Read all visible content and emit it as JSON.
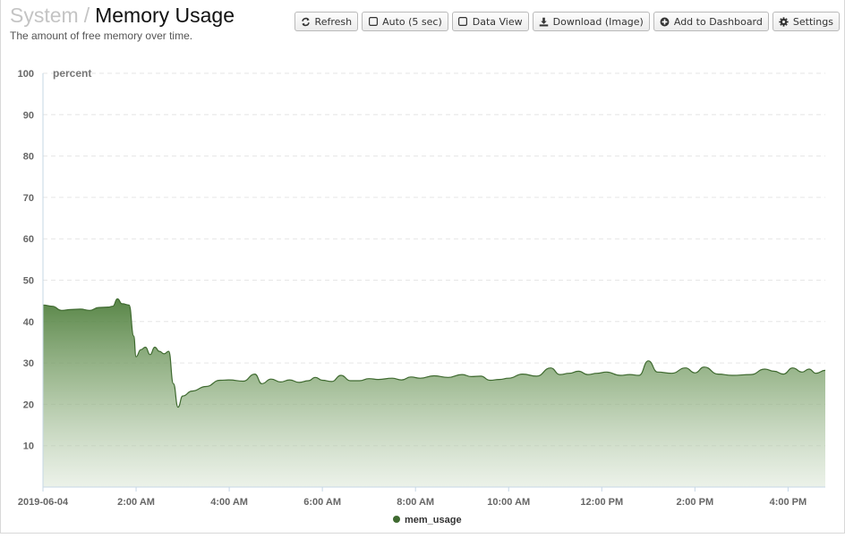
{
  "header": {
    "breadcrumb_parent": "System",
    "separator": "/",
    "title": "Memory Usage",
    "subtitle": "The amount of free memory over time."
  },
  "toolbar": {
    "refresh": {
      "label": "Refresh",
      "icon": "refresh-icon"
    },
    "auto": {
      "label": "Auto (5 sec)",
      "icon": "checkbox-icon",
      "checked": false
    },
    "data_view": {
      "label": "Data View",
      "icon": "checkbox-icon",
      "checked": false
    },
    "download": {
      "label": "Download (Image)",
      "icon": "download-icon"
    },
    "add_dashboard": {
      "label": "Add to Dashboard",
      "icon": "plus-circle-icon"
    },
    "settings": {
      "label": "Settings",
      "icon": "gear-icon"
    }
  },
  "chart_data": {
    "type": "area",
    "ylabel": "percent",
    "ylim": [
      0,
      100
    ],
    "y_ticks": [
      "10",
      "20",
      "30",
      "40",
      "50",
      "60",
      "70",
      "80",
      "90",
      "100"
    ],
    "x_tick_labels": [
      "2019-06-04",
      "2:00 AM",
      "4:00 AM",
      "6:00 AM",
      "8:00 AM",
      "10:00 AM",
      "12:00 PM",
      "2:00 PM",
      "4:00 PM"
    ],
    "x_range_hours": [
      0,
      16.8
    ],
    "grid": true,
    "legend_position": "bottom",
    "series": [
      {
        "name": "mem_usage",
        "color": "#3f6a30",
        "points": [
          [
            0,
            44.0
          ],
          [
            0.2,
            43.7
          ],
          [
            0.4,
            42.7
          ],
          [
            0.6,
            42.9
          ],
          [
            0.8,
            43.0
          ],
          [
            1.0,
            42.7
          ],
          [
            1.2,
            43.4
          ],
          [
            1.4,
            43.5
          ],
          [
            1.5,
            43.7
          ],
          [
            1.6,
            45.5
          ],
          [
            1.7,
            44.3
          ],
          [
            1.85,
            44.0
          ],
          [
            1.95,
            36.5
          ],
          [
            2.0,
            31.5
          ],
          [
            2.1,
            33.2
          ],
          [
            2.2,
            33.8
          ],
          [
            2.3,
            32.0
          ],
          [
            2.4,
            33.8
          ],
          [
            2.5,
            32.8
          ],
          [
            2.6,
            32.2
          ],
          [
            2.7,
            32.8
          ],
          [
            2.8,
            25.0
          ],
          [
            2.9,
            19.3
          ],
          [
            3.0,
            22.0
          ],
          [
            3.2,
            23.2
          ],
          [
            3.5,
            24.3
          ],
          [
            3.8,
            25.8
          ],
          [
            4.0,
            25.9
          ],
          [
            4.3,
            25.6
          ],
          [
            4.55,
            27.3
          ],
          [
            4.7,
            25.0
          ],
          [
            4.9,
            26.1
          ],
          [
            5.1,
            25.4
          ],
          [
            5.3,
            25.9
          ],
          [
            5.5,
            25.3
          ],
          [
            5.7,
            25.7
          ],
          [
            5.85,
            26.5
          ],
          [
            6.0,
            25.8
          ],
          [
            6.2,
            25.5
          ],
          [
            6.4,
            27.0
          ],
          [
            6.6,
            25.7
          ],
          [
            6.8,
            25.7
          ],
          [
            7.0,
            26.2
          ],
          [
            7.2,
            26.0
          ],
          [
            7.5,
            26.3
          ],
          [
            7.7,
            25.9
          ],
          [
            7.9,
            26.6
          ],
          [
            8.1,
            26.3
          ],
          [
            8.4,
            26.9
          ],
          [
            8.7,
            26.5
          ],
          [
            9.0,
            27.2
          ],
          [
            9.2,
            26.7
          ],
          [
            9.4,
            26.8
          ],
          [
            9.6,
            25.8
          ],
          [
            9.8,
            26.0
          ],
          [
            10.0,
            26.3
          ],
          [
            10.3,
            27.3
          ],
          [
            10.6,
            26.8
          ],
          [
            10.9,
            28.8
          ],
          [
            11.1,
            27.2
          ],
          [
            11.3,
            27.5
          ],
          [
            11.5,
            28.0
          ],
          [
            11.7,
            27.2
          ],
          [
            11.9,
            27.5
          ],
          [
            12.1,
            27.8
          ],
          [
            12.4,
            27.0
          ],
          [
            12.6,
            27.2
          ],
          [
            12.8,
            27.0
          ],
          [
            13.0,
            30.5
          ],
          [
            13.2,
            27.8
          ],
          [
            13.5,
            27.5
          ],
          [
            13.8,
            28.8
          ],
          [
            14.0,
            27.6
          ],
          [
            14.2,
            29.0
          ],
          [
            14.5,
            27.3
          ],
          [
            14.8,
            27.0
          ],
          [
            15.2,
            27.2
          ],
          [
            15.5,
            28.5
          ],
          [
            15.7,
            28.0
          ],
          [
            15.9,
            27.3
          ],
          [
            16.1,
            28.8
          ],
          [
            16.3,
            27.8
          ],
          [
            16.45,
            28.5
          ],
          [
            16.6,
            27.5
          ],
          [
            16.8,
            28.2
          ]
        ]
      }
    ]
  }
}
